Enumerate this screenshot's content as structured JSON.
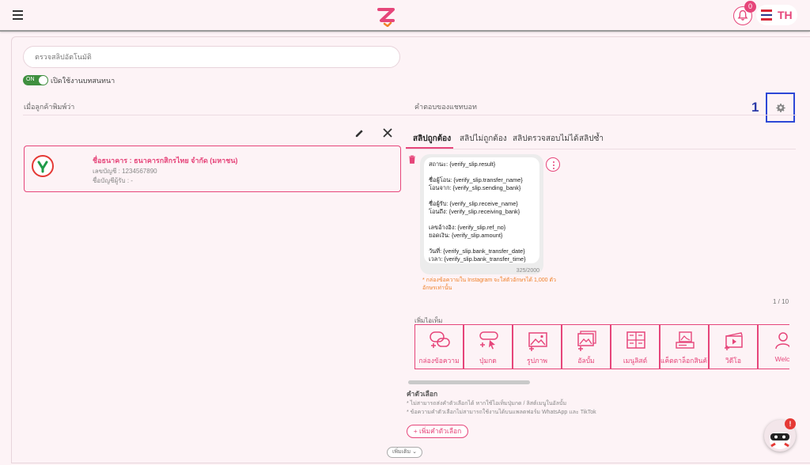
{
  "header": {
    "notification_count": "0",
    "language": "TH"
  },
  "form": {
    "title_value": "ตรวจสลิปอัตโนมัติ",
    "toggle_state": "ON",
    "toggle_label": "เปิดใช้งานบทสนทนา",
    "left_label": "เมื่อลูกค้าพิมพ์ว่า",
    "right_label": "คำตอบของแชทบอท",
    "annotation_number": "1"
  },
  "bank": {
    "title": "ชื่อธนาคาร : ธนาคารกสิกรไทย จำกัด (มหาชน)",
    "account_no": "เลขบัญชี : 1234567890",
    "account_name": "ชื่อบัญชีผู้รับ : -"
  },
  "tabs": [
    {
      "label": "สลิปถูกต้อง",
      "active": true
    },
    {
      "label": "สลิปไม่ถูกต้อง",
      "active": false
    },
    {
      "label": "สลิปตรวจสอบไม่ได้",
      "active": false
    },
    {
      "label": "สลิปซ้ำ",
      "active": false
    }
  ],
  "message": {
    "lines": [
      "สถานะ: {verify_slip.result}",
      "",
      "ชื่อผู้โอน: {verify_slip.transfer_name}",
      "โอนจาก: {verify_slip.sending_bank}",
      "",
      "ชื่อผู้รับ: {verify_slip.receive_name}",
      "โอนถึง: {verify_slip.receiving_bank}",
      "",
      "เลขอ้างอิง: {verify_slip.ref_no}",
      "ยอดเงิน: {verify_slip.amount}",
      "",
      "วันที่: {verify_slip.bank_transfer_date}",
      "เวลา: {verify_slip.bank_transfer_time}"
    ],
    "char_count": "325/2000",
    "instagram_note": "* กล่องข้อความใน Instagram จะใส่ตัวอักษรได้ 1,000 ตัวอักษรเท่านั้น"
  },
  "page_count": "1 / 10",
  "add_item": {
    "label": "เพิ่มไอเท็ม",
    "items": [
      {
        "label": "กล่องข้อความ",
        "icon": "message-box-icon"
      },
      {
        "label": "ปุ่มกด",
        "icon": "button-icon"
      },
      {
        "label": "รูปภาพ",
        "icon": "image-icon"
      },
      {
        "label": "อัลบั้ม",
        "icon": "album-icon"
      },
      {
        "label": "เมนูลิสต์",
        "icon": "menu-list-icon"
      },
      {
        "label": "แค็ตตาล็อกสินค้า",
        "icon": "catalog-icon"
      },
      {
        "label": "วิดีโอ",
        "icon": "video-icon"
      },
      {
        "label": "Welc",
        "icon": "welcome-icon"
      }
    ]
  },
  "options": {
    "title": "คำตัวเลือก",
    "note1": "* ไม่สามารถส่งคำตัวเลือกได้ หากใช้ไอเท็มปุ่มกด / ลิสต์เมนูในอัลบั้ม",
    "note2": "* ข้อความคำตัวเลือกไม่สามารถใช้งานได้บนแพลตฟอร์ม WhatsApp และ TikTok",
    "add_label": "เพิ่มคำตัวเลือก"
  },
  "more_label": "เพิ่มเติม",
  "chat_badge": "!",
  "colors": {
    "accent": "#e6457a",
    "background": "#fdf3f6",
    "highlight": "#2d48d6"
  }
}
